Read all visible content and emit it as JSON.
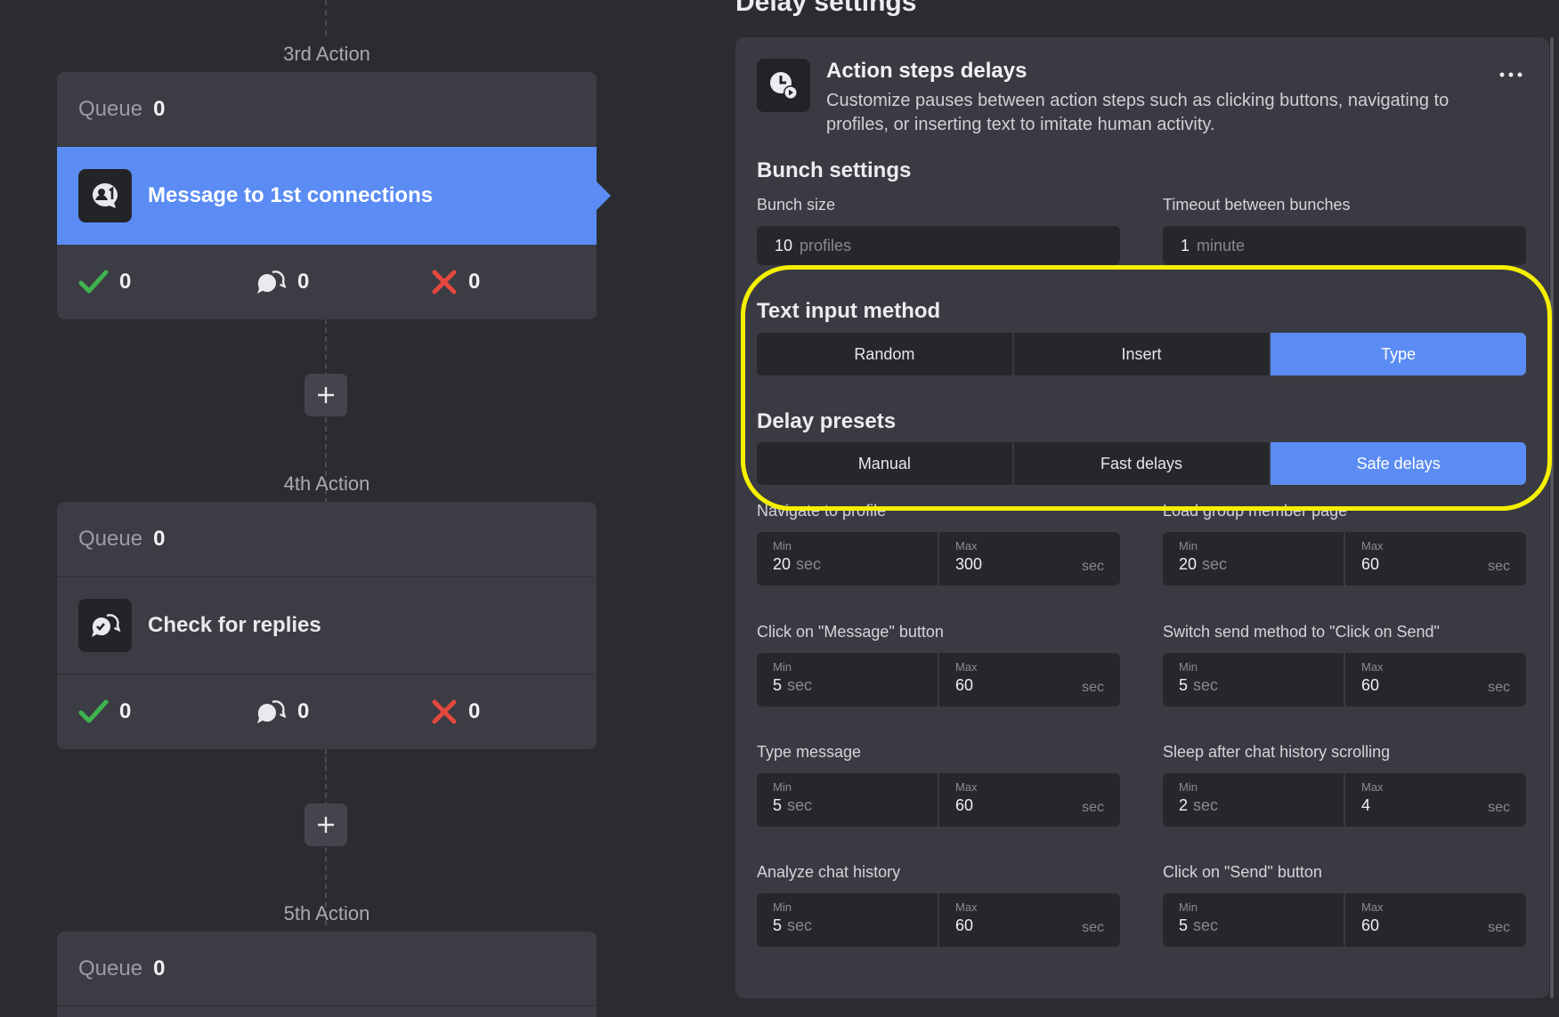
{
  "flow": {
    "actions": [
      {
        "label": "3rd Action",
        "queue_label": "Queue",
        "queue_count": "0",
        "step_title": "Message to 1st connections",
        "step_icon": "message-contact-icon",
        "active": true,
        "stats": {
          "success": "0",
          "replied": "0",
          "failed": "0"
        }
      },
      {
        "label": "4th Action",
        "queue_label": "Queue",
        "queue_count": "0",
        "step_title": "Check for replies",
        "step_icon": "check-replies-icon",
        "active": false,
        "stats": {
          "success": "0",
          "replied": "0",
          "failed": "0"
        }
      },
      {
        "label": "5th Action",
        "queue_label": "Queue",
        "queue_count": "0"
      }
    ]
  },
  "settings": {
    "page_title": "Delay settings",
    "header": {
      "title": "Action steps delays",
      "description": "Customize pauses between action steps such as clicking buttons, navigating to profiles, or inserting text to imitate human activity."
    },
    "bunch": {
      "title": "Bunch settings",
      "size_label": "Bunch size",
      "size_value": "10",
      "size_unit": "profiles",
      "timeout_label": "Timeout between bunches",
      "timeout_value": "1",
      "timeout_unit": "minute"
    },
    "text_input": {
      "title": "Text input method",
      "options": [
        "Random",
        "Insert",
        "Type"
      ],
      "selected": "Type"
    },
    "presets": {
      "title": "Delay presets",
      "options": [
        "Manual",
        "Fast delays",
        "Safe delays"
      ],
      "selected": "Safe delays"
    },
    "range_labels": {
      "min": "Min",
      "max": "Max",
      "unit": "sec"
    },
    "delays": [
      {
        "label": "Navigate to profile",
        "min": "20",
        "max": "300"
      },
      {
        "label": "Load group member page",
        "min": "20",
        "max": "60"
      },
      {
        "label": "Click on \"Message\" button",
        "min": "5",
        "max": "60"
      },
      {
        "label": "Switch send method to \"Click on Send\"",
        "min": "5",
        "max": "60"
      },
      {
        "label": "Type message",
        "min": "5",
        "max": "60"
      },
      {
        "label": "Sleep after chat history scrolling",
        "min": "2",
        "max": "4"
      },
      {
        "label": "Analyze chat history",
        "min": "5",
        "max": "60"
      },
      {
        "label": "Click on \"Send\" button",
        "min": "5",
        "max": "60"
      }
    ]
  },
  "colors": {
    "accent": "#5b8cf3",
    "highlight": "#f5f000",
    "success": "#3fb34f",
    "failure": "#e5483f"
  }
}
